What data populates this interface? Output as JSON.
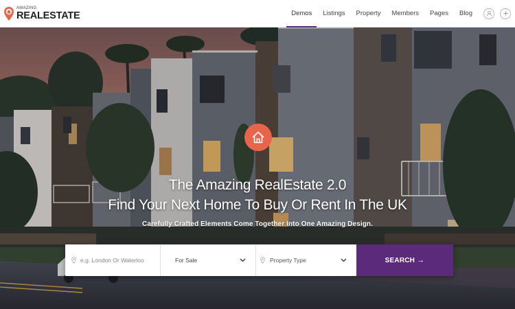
{
  "logo": {
    "small": "AMAZING",
    "big": "REALESTATE"
  },
  "nav": {
    "items": [
      {
        "label": "Demos",
        "active": true
      },
      {
        "label": "Listings",
        "active": false
      },
      {
        "label": "Property",
        "active": false
      },
      {
        "label": "Members",
        "active": false
      },
      {
        "label": "Pages",
        "active": false
      },
      {
        "label": "Blog",
        "active": false
      }
    ],
    "icons": [
      "user-icon",
      "plus-icon"
    ]
  },
  "hero": {
    "badge_icon": "home-icon",
    "title_line1": "The Amazing RealEstate 2.0",
    "title_line2": "Find Your Next Home To Buy Or Rent In The UK",
    "subtitle": "Carefully Crafted Elements Come Together Into One Amazing Design."
  },
  "search": {
    "location_placeholder": "e.g. London Or Waterloo",
    "sale_value": "For Sale",
    "type_value": "Property Type",
    "button_label": "SEARCH",
    "button_arrow": "→"
  },
  "colors": {
    "accent": "#5b2a7a",
    "badge": "#e8644a",
    "logo_orange": "#e8644a"
  }
}
